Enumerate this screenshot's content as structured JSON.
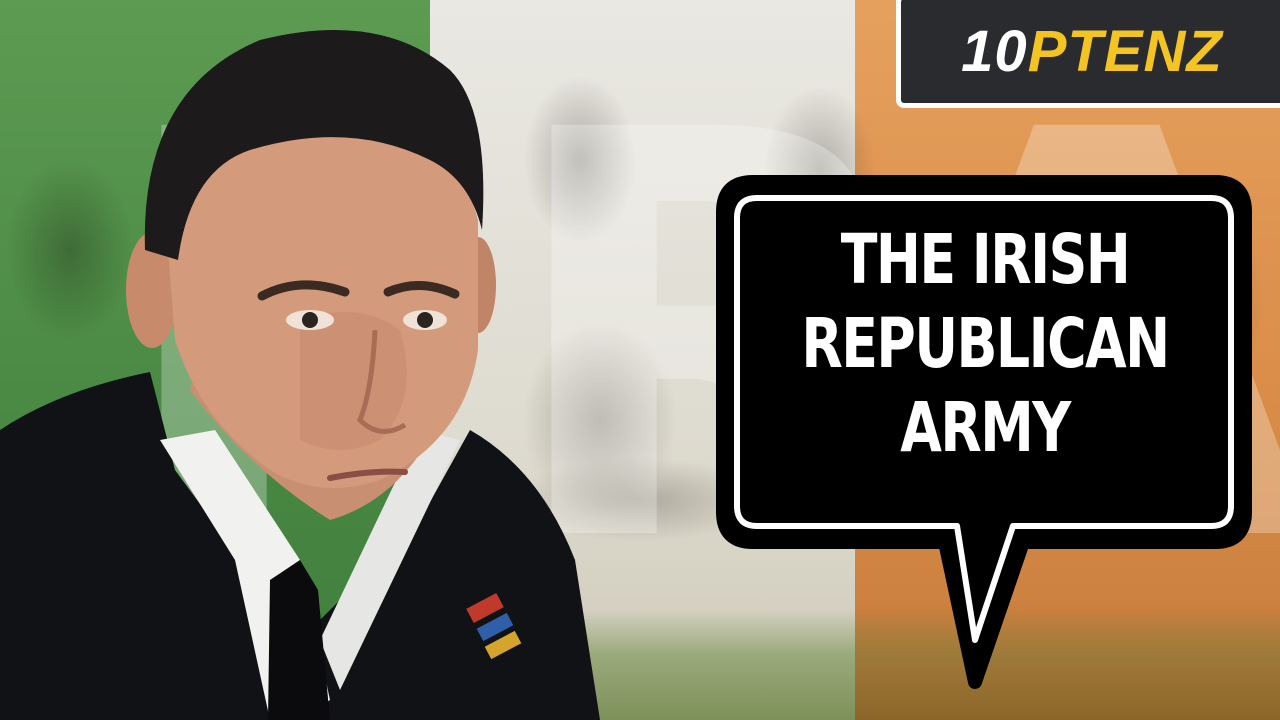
{
  "logo": {
    "number": "10",
    "word": "PTENZ"
  },
  "background": {
    "letters": [
      "I",
      "R",
      "A"
    ],
    "flag_colors": {
      "green": "#4a8a44",
      "white": "#e6e4dc",
      "orange": "#d98d48"
    }
  },
  "headline": {
    "lines": [
      "THE IRISH",
      "REPUBLICAN",
      "ARMY"
    ]
  },
  "colors": {
    "logo_yellow": "#f4c422",
    "bubble_fill": "#000000",
    "bubble_outline": "#ffffff"
  }
}
